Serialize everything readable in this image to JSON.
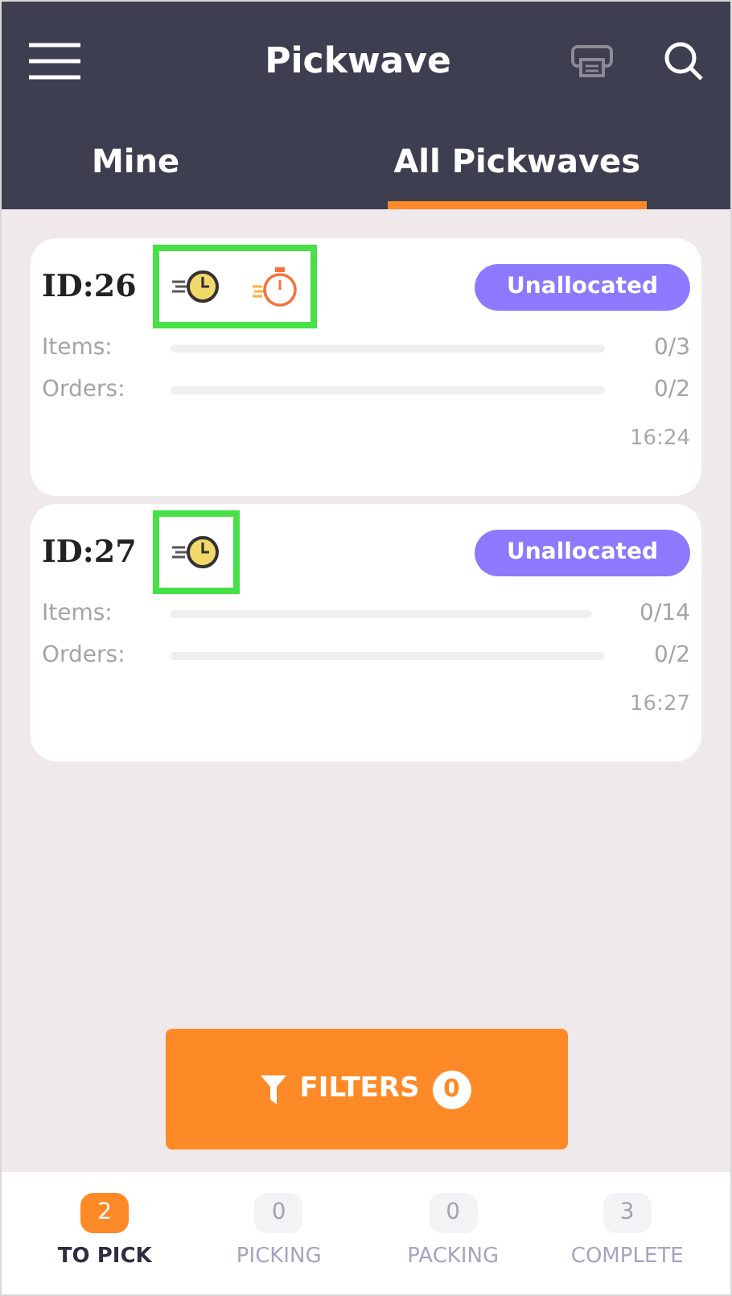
{
  "header": {
    "title": "Pickwave"
  },
  "tabs": [
    {
      "label": "Mine",
      "selected": false
    },
    {
      "label": "All Pickwaves",
      "selected": true
    }
  ],
  "pickwaves": [
    {
      "id": "ID:26",
      "icons": [
        {
          "kind": "fast-clock"
        },
        {
          "kind": "stopwatch"
        }
      ],
      "highlighted": true,
      "status": "Unallocated",
      "progress": [
        {
          "label": "Items:",
          "count": "0/3",
          "level": 0
        },
        {
          "label": "Orders:",
          "count": "0/2",
          "level": 0
        }
      ],
      "time": "16:24"
    },
    {
      "id": "ID:27",
      "icons": [
        {
          "kind": "fast-clock"
        }
      ],
      "highlighted": true,
      "status": "Unallocated",
      "progress": [
        {
          "label": "Items:",
          "count": "0/14",
          "level": 0
        },
        {
          "label": "Orders:",
          "count": "0/2",
          "level": 0
        }
      ],
      "time": "16:27"
    }
  ],
  "filters_button": {
    "label": "FILTERS",
    "count": "0"
  },
  "bottom_nav": [
    {
      "count": "2",
      "label": "TO PICK",
      "selected": true
    },
    {
      "count": "0",
      "label": "PICKING",
      "selected": false
    },
    {
      "count": "0",
      "label": "PACKING",
      "selected": false
    },
    {
      "count": "3",
      "label": "COMPLETE",
      "selected": false
    }
  ]
}
